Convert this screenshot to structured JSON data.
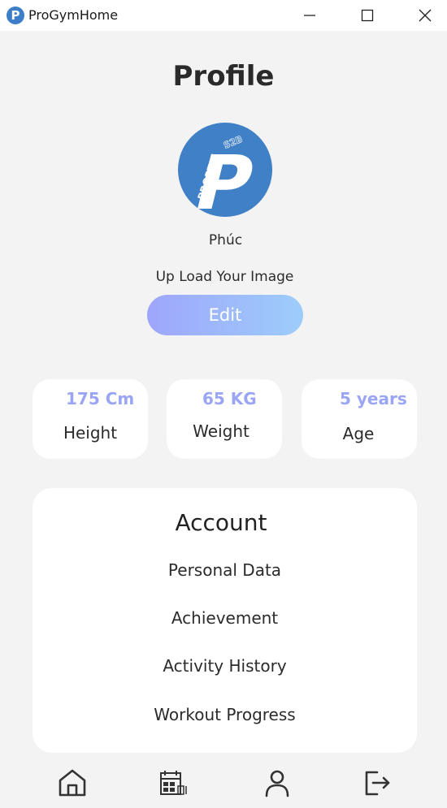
{
  "window": {
    "title": "ProGymHome",
    "app_icon": "progym-logo-icon",
    "controls": [
      "minimize-icon",
      "maximize-icon",
      "close-icon"
    ]
  },
  "page": {
    "title": "Profile"
  },
  "profile": {
    "avatar_text_main": "P",
    "avatar_text_side": "PROPTIT",
    "avatar_text_top": "S2B",
    "name": "Phúc",
    "upload_label": "Up Load Your Image",
    "edit_label": "Edit"
  },
  "stats": [
    {
      "value": "175 Cm",
      "label": "Height"
    },
    {
      "value": "65 KG",
      "label": "Weight"
    },
    {
      "value": "5 years",
      "label": "Age"
    }
  ],
  "account": {
    "title": "Account",
    "items": [
      "Personal Data",
      "Achievement",
      "Activity History",
      "Workout Progress"
    ]
  },
  "nav": {
    "items": [
      "home-icon",
      "schedule-icon",
      "user-icon",
      "logout-icon"
    ]
  },
  "colors": {
    "accent": "#9aa5f4",
    "button_gradient_start": "#9ea6fb",
    "button_gradient_end": "#9dcdfb",
    "avatar_blue": "#3f80c6",
    "background": "#f3f3f3",
    "card": "#ffffff"
  }
}
